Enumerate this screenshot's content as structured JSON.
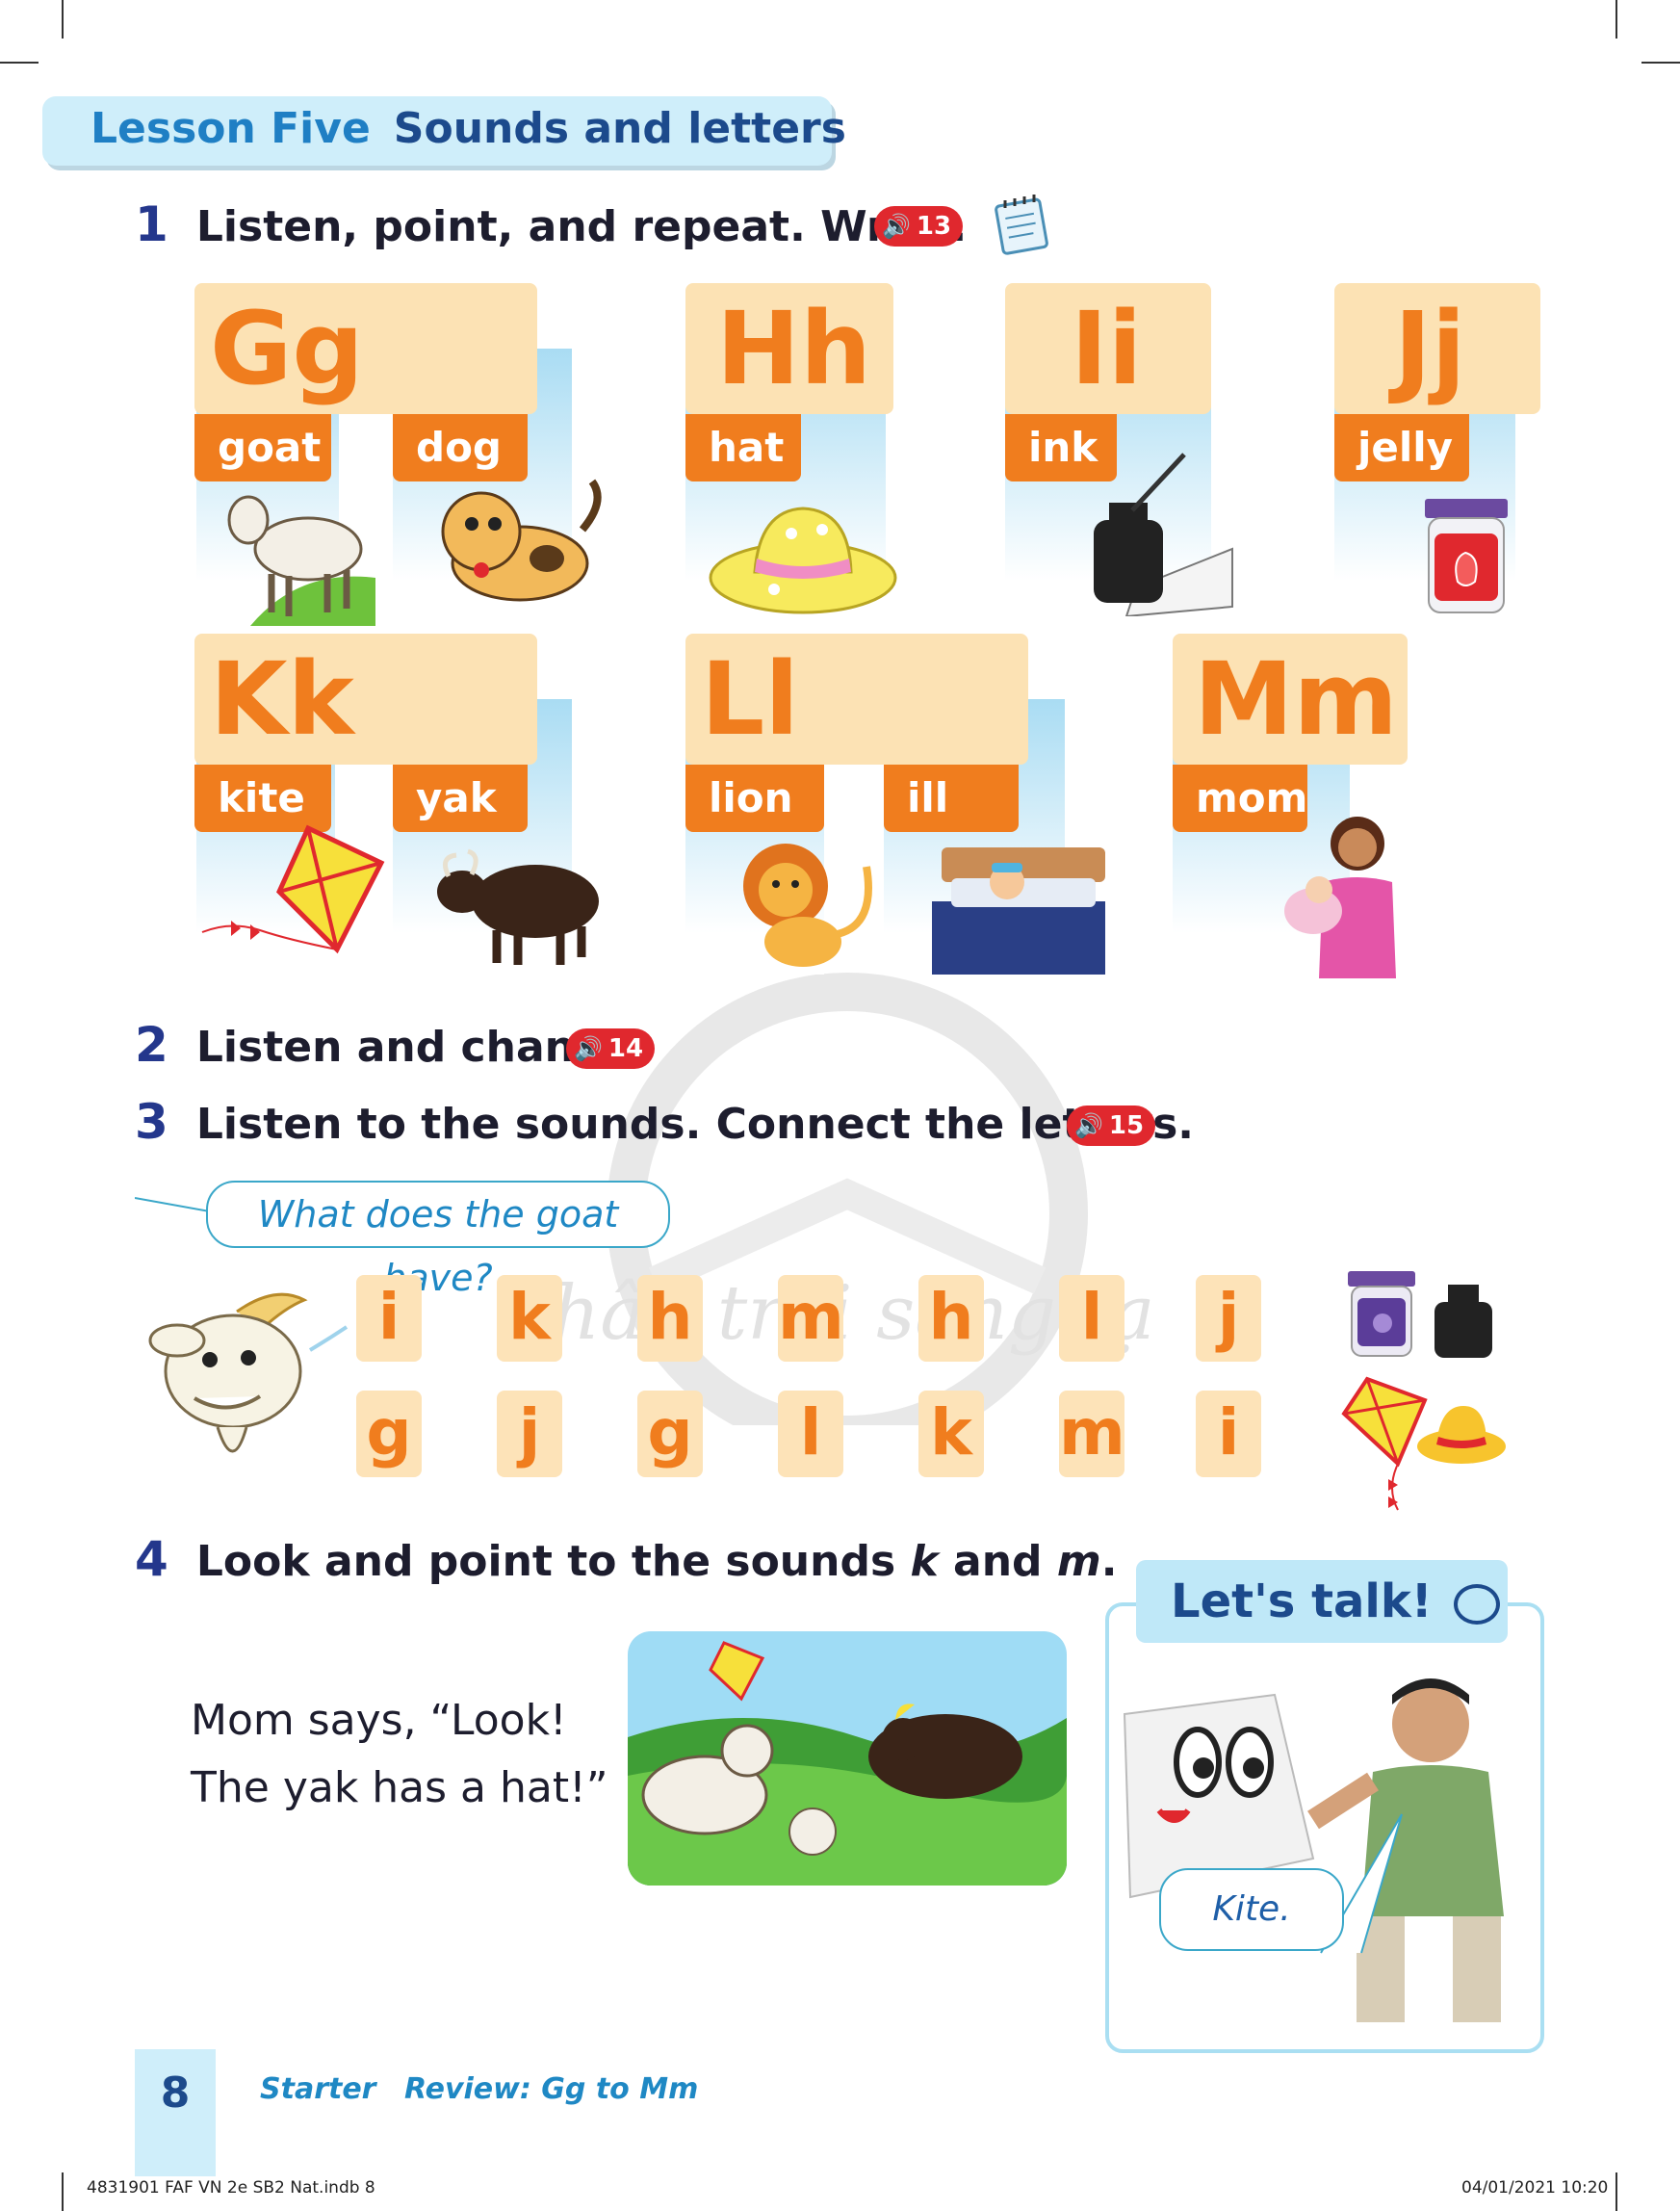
{
  "header": {
    "lesson": "Lesson Five",
    "title": "Sounds and letters"
  },
  "ex1": {
    "num": "1",
    "text": "Listen, point, and repeat. Write.",
    "audio": "13"
  },
  "cards": [
    {
      "letter": "Gg",
      "words": [
        "goat",
        "dog"
      ]
    },
    {
      "letter": "Hh",
      "words": [
        "hat"
      ]
    },
    {
      "letter": "Ii",
      "words": [
        "ink"
      ]
    },
    {
      "letter": "Jj",
      "words": [
        "jelly"
      ]
    },
    {
      "letter": "Kk",
      "words": [
        "kite",
        "yak"
      ]
    },
    {
      "letter": "Ll",
      "words": [
        "lion",
        "ill"
      ]
    },
    {
      "letter": "Mm",
      "words": [
        "mom"
      ]
    }
  ],
  "ex2": {
    "num": "2",
    "text": "Listen and chant.",
    "audio": "14"
  },
  "ex3": {
    "num": "3",
    "text": "Listen to the sounds. Connect the letters.",
    "audio": "15"
  },
  "speech": "What does the goat have?",
  "letters_top": [
    "i",
    "k",
    "h",
    "m",
    "h",
    "l",
    "j"
  ],
  "letters_bottom": [
    "g",
    "j",
    "g",
    "l",
    "k",
    "m",
    "i"
  ],
  "ex4": {
    "num": "4",
    "text_a": "Look and point to the sounds ",
    "k": "k",
    "and": " and ",
    "m": "m",
    "dot": "."
  },
  "story": "Mom says, “Look!\nThe yak has a hat!”",
  "lets_talk": {
    "title": "Let's talk!",
    "bubble": "Kite."
  },
  "footer": {
    "page": "8",
    "unit": "Starter",
    "review": "Review: Gg to Mm"
  },
  "slug": {
    "left": "4831901 FAF VN 2e SB2 Nat.indb   8",
    "right": "04/01/2021   10:20"
  },
  "watermark": "Chân trời sáng tạo",
  "colors": {
    "orange": "#f07d1e",
    "navy": "#24378c",
    "sky": "#cfeefa",
    "red": "#e0282e"
  }
}
